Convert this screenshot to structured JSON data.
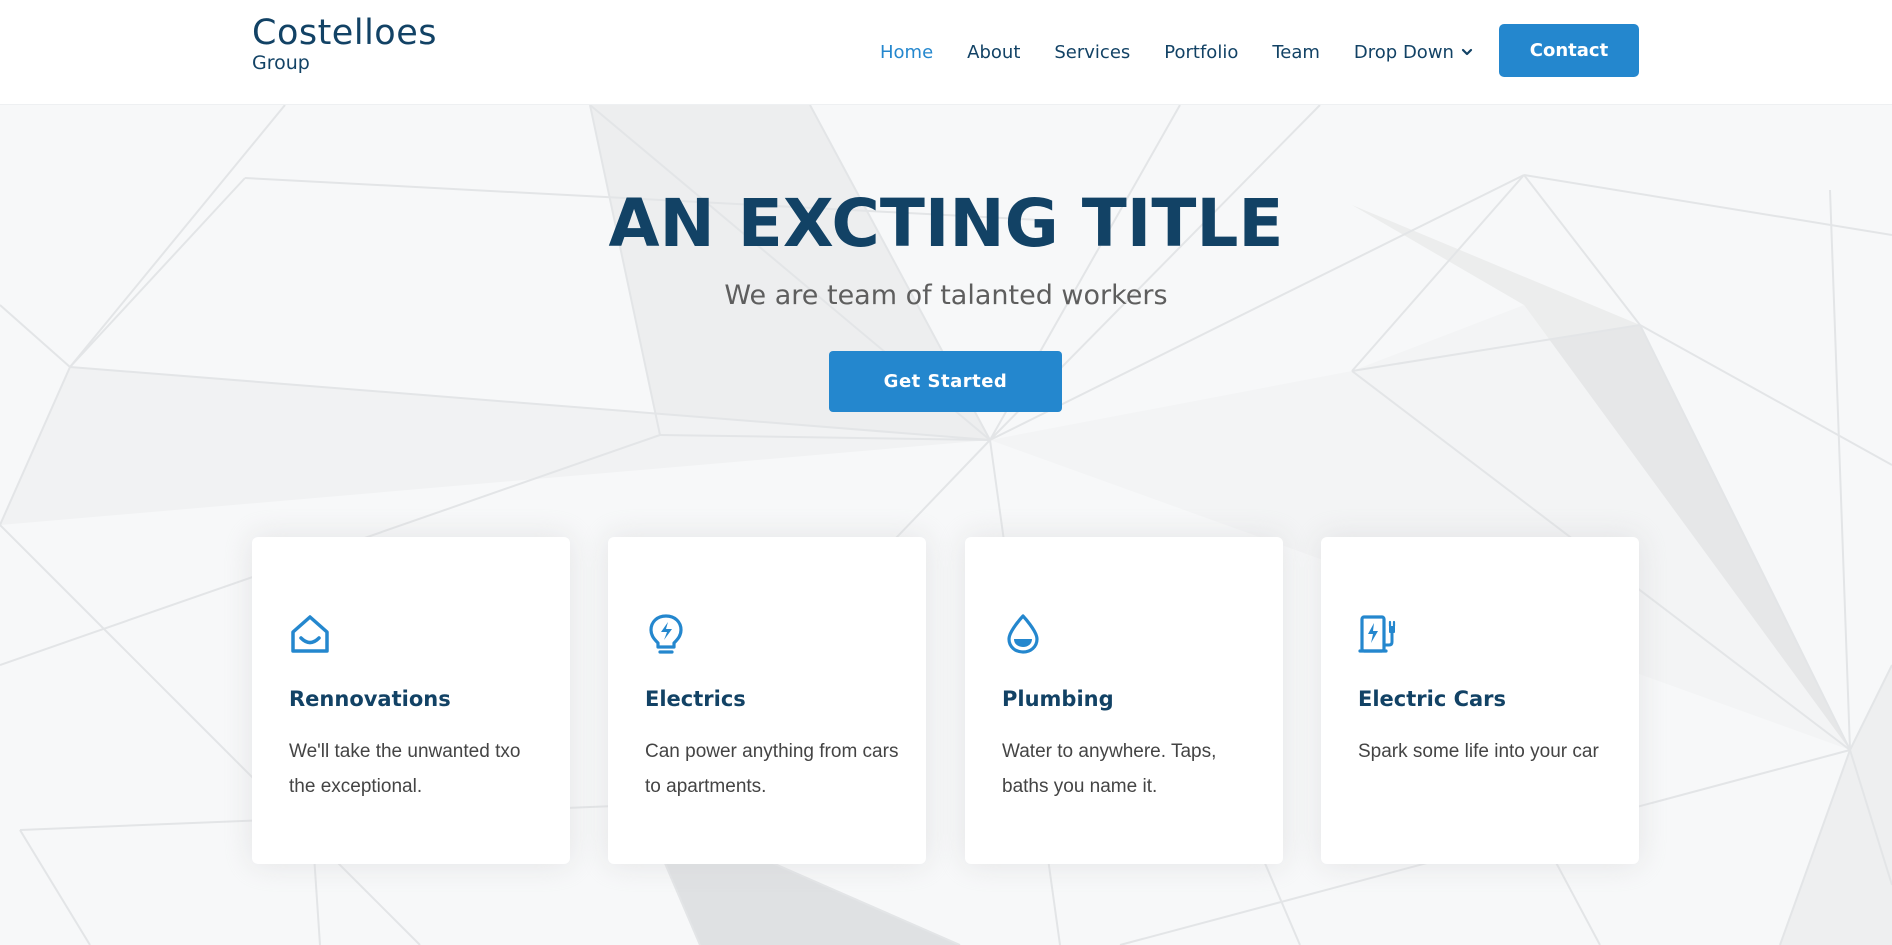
{
  "brand": {
    "name": "Costelloes",
    "tagline": "Group"
  },
  "nav": {
    "items": [
      {
        "label": "Home",
        "active": true
      },
      {
        "label": "About"
      },
      {
        "label": "Services"
      },
      {
        "label": "Portfolio"
      },
      {
        "label": "Team"
      },
      {
        "label": "Drop Down",
        "has_dropdown": true
      }
    ],
    "contact_label": "Contact"
  },
  "hero": {
    "title": "AN EXCTING TITLE",
    "subtitle": "We are team of talanted workers",
    "cta_label": "Get Started"
  },
  "services": [
    {
      "icon": "house-smile-icon",
      "title": "Rennovations",
      "description": "We'll take the unwanted txo the exceptional."
    },
    {
      "icon": "lightbulb-bolt-icon",
      "title": "Electrics",
      "description": "Can power anything from cars to apartments."
    },
    {
      "icon": "water-drop-icon",
      "title": "Plumbing",
      "description": "Water to anywhere. Taps, baths you name it."
    },
    {
      "icon": "ev-charging-station-icon",
      "title": "Electric Cars",
      "description": "Spark some life into your car"
    }
  ],
  "colors": {
    "brand_dark": "#124265",
    "accent": "#2487ce",
    "text_muted": "#5e5e5e",
    "body_text": "#444444"
  }
}
